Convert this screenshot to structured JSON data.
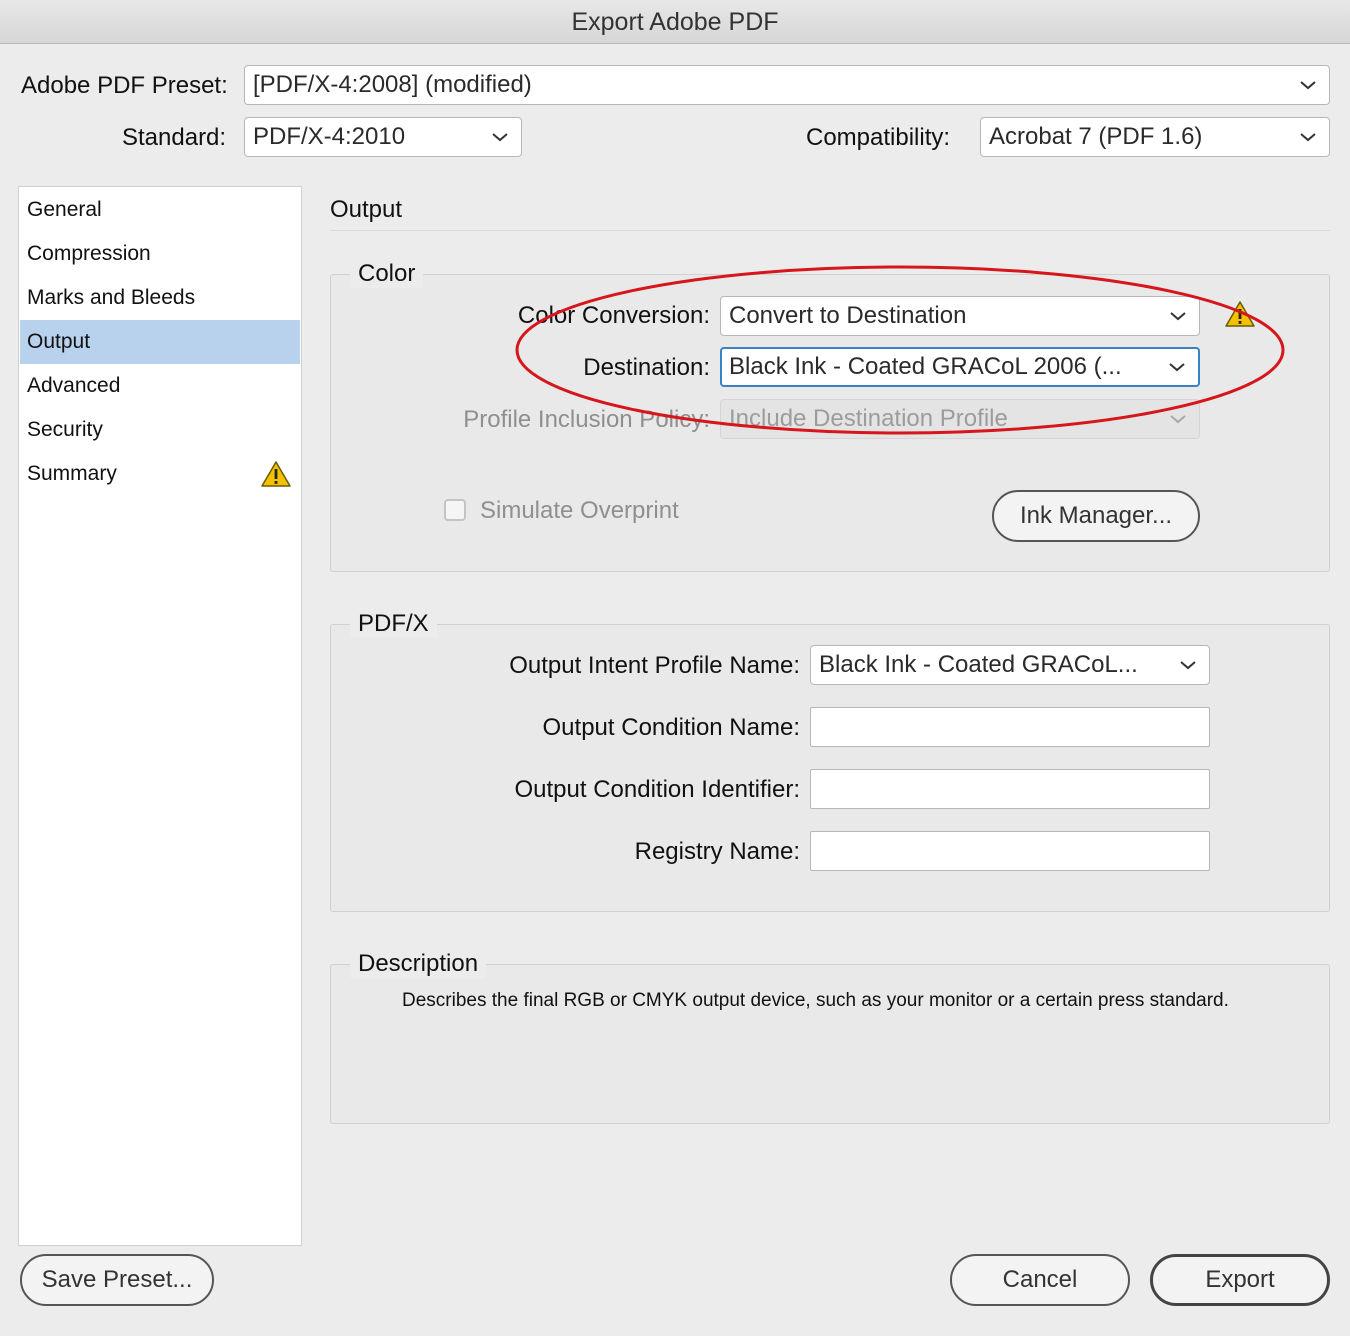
{
  "window": {
    "title": "Export Adobe PDF"
  },
  "preset": {
    "label": "Adobe PDF Preset:",
    "value": "[PDF/X-4:2008] (modified)"
  },
  "standard": {
    "label": "Standard:",
    "value": "PDF/X-4:2010"
  },
  "compatibility": {
    "label": "Compatibility:",
    "value": "Acrobat 7 (PDF 1.6)"
  },
  "sidebar": {
    "items": [
      {
        "label": "General"
      },
      {
        "label": "Compression"
      },
      {
        "label": "Marks and Bleeds"
      },
      {
        "label": "Output",
        "selected": true
      },
      {
        "label": "Advanced"
      },
      {
        "label": "Security"
      },
      {
        "label": "Summary",
        "warning": true
      }
    ]
  },
  "main": {
    "title": "Output",
    "color_group": {
      "label": "Color",
      "conversion_label": "Color Conversion:",
      "conversion_value": "Convert to Destination",
      "destination_label": "Destination:",
      "destination_value": "Black Ink - Coated GRACoL 2006 (...",
      "profile_policy_label": "Profile Inclusion Policy:",
      "profile_policy_value": "Include Destination Profile",
      "simulate_overprint_label": "Simulate Overprint",
      "simulate_overprint_checked": false,
      "ink_manager_label": "Ink Manager..."
    },
    "pdfx_group": {
      "label": "PDF/X",
      "intent_profile_label": "Output Intent Profile Name:",
      "intent_profile_value": "Black Ink - Coated GRACoL...",
      "condition_name_label": "Output Condition Name:",
      "condition_name_value": "",
      "condition_id_label": "Output Condition Identifier:",
      "condition_id_value": "",
      "registry_label": "Registry Name:",
      "registry_value": ""
    },
    "description_group": {
      "label": "Description",
      "text": "Describes the final RGB or CMYK output device, such as your monitor or a certain press standard."
    }
  },
  "footer": {
    "save_preset": "Save Preset...",
    "cancel": "Cancel",
    "export": "Export"
  },
  "colors": {
    "selection": "#b8d2ee",
    "focus": "#3b82c4",
    "warning": "#f2c200",
    "annotation": "#d7161b"
  },
  "icons": {
    "warning": "warning-triangle-icon",
    "dropdown": "chevron-down-icon"
  }
}
